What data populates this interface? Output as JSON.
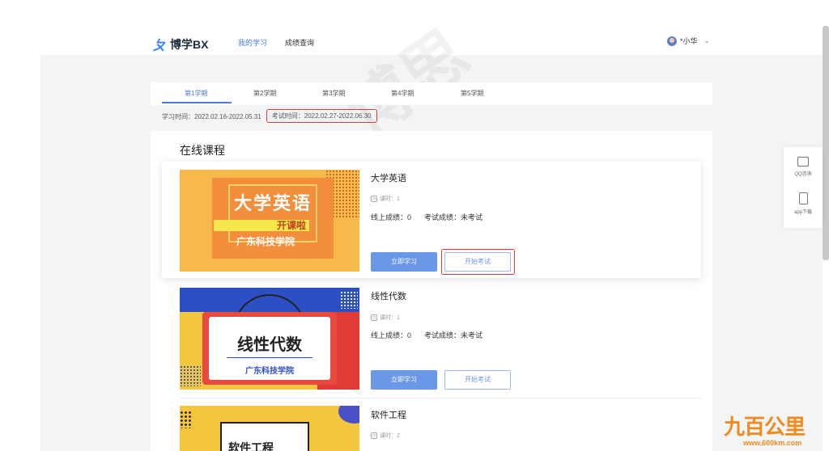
{
  "header": {
    "logo_text": "博学BX",
    "nav": [
      "我的学习",
      "成绩查询"
    ],
    "active_nav": "我的学习",
    "user_name": "*小华"
  },
  "terms": {
    "tabs": [
      "第1学期",
      "第2学期",
      "第3学期",
      "第4学期",
      "第5学期"
    ],
    "active": "第1学期",
    "study_time": "学习时间：2022.02.16-2022.05.31",
    "exam_time": "考试时间：2022.02.27-2022.06.30"
  },
  "section_title": "在线课程",
  "courses": [
    {
      "title": "大学英语",
      "hours": "课时：1",
      "online_score": "线上成绩：0",
      "exam_score": "考试成绩：未考试",
      "study_label": "立即学习",
      "exam_label": "开始考试",
      "thumb_main": "大学英语",
      "thumb_sub": "开课啦",
      "thumb_school": "广东科技学院"
    },
    {
      "title": "线性代数",
      "hours": "课时：1",
      "online_score": "线上成绩：0",
      "exam_score": "考试成绩：未考试",
      "study_label": "立即学习",
      "exam_label": "开始考试",
      "thumb_main": "线性代数",
      "thumb_school": "广东科技学院"
    },
    {
      "title": "软件工程",
      "hours": "课时：2",
      "thumb_main": "软件工程"
    }
  ],
  "side_panel": {
    "qq_label": "QQ咨询",
    "app_label": "app下载"
  },
  "watermark": {
    "logo": "九百公里",
    "url": "www.600km.com"
  },
  "colors": {
    "accent": "#4a7ae0",
    "button": "#6b97e8",
    "highlight_border": "#e53935",
    "watermark": "#f08a1c"
  }
}
